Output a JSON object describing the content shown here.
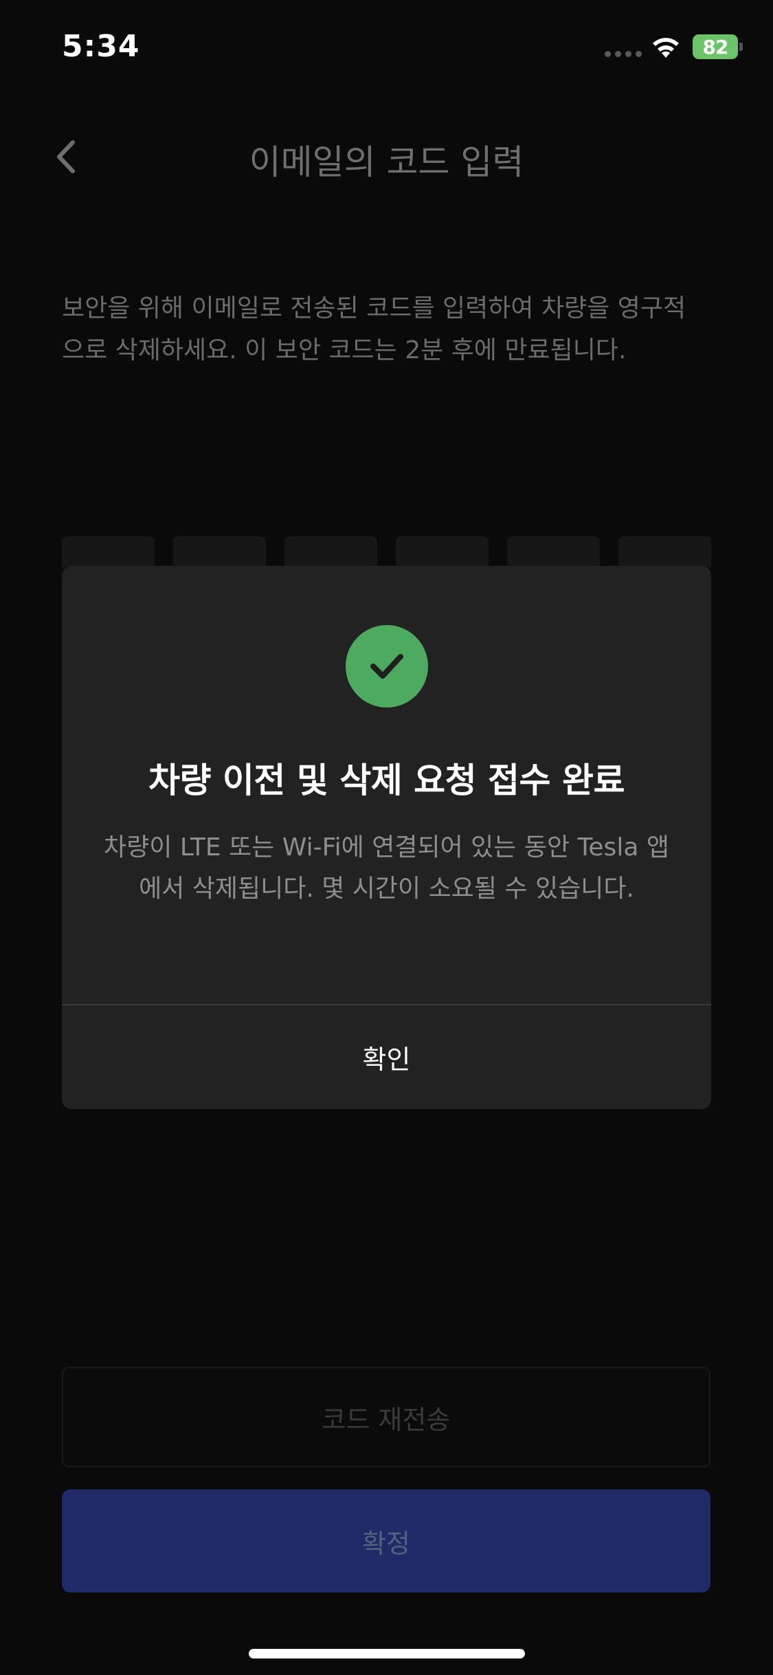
{
  "status_bar": {
    "time": "5:34",
    "battery": "82"
  },
  "header": {
    "title": "이메일의 코드 입력"
  },
  "description": "보안을 위해 이메일로 전송된 코드를 입력하여 차량을 영구적으로 삭제하세요. 이 보안 코드는 2분 후에 만료됩니다.",
  "buttons": {
    "resend": "코드 재전송",
    "confirm": "확정"
  },
  "modal": {
    "title": "차량 이전 및 삭제 요청 접수 완료",
    "body": "차량이 LTE 또는 Wi-Fi에 연결되어 있는 동안 Tesla 앱에서 삭제됩니다. 몇 시간이 소요될 수 있습니다.",
    "ok_label": "확인"
  },
  "colors": {
    "success": "#4eaa60",
    "battery": "#6cc36a",
    "primary_button": "#1f2a66"
  },
  "icons": {
    "back": "chevron-left-icon",
    "success": "checkmark-circle-icon",
    "wifi": "wifi-icon"
  }
}
